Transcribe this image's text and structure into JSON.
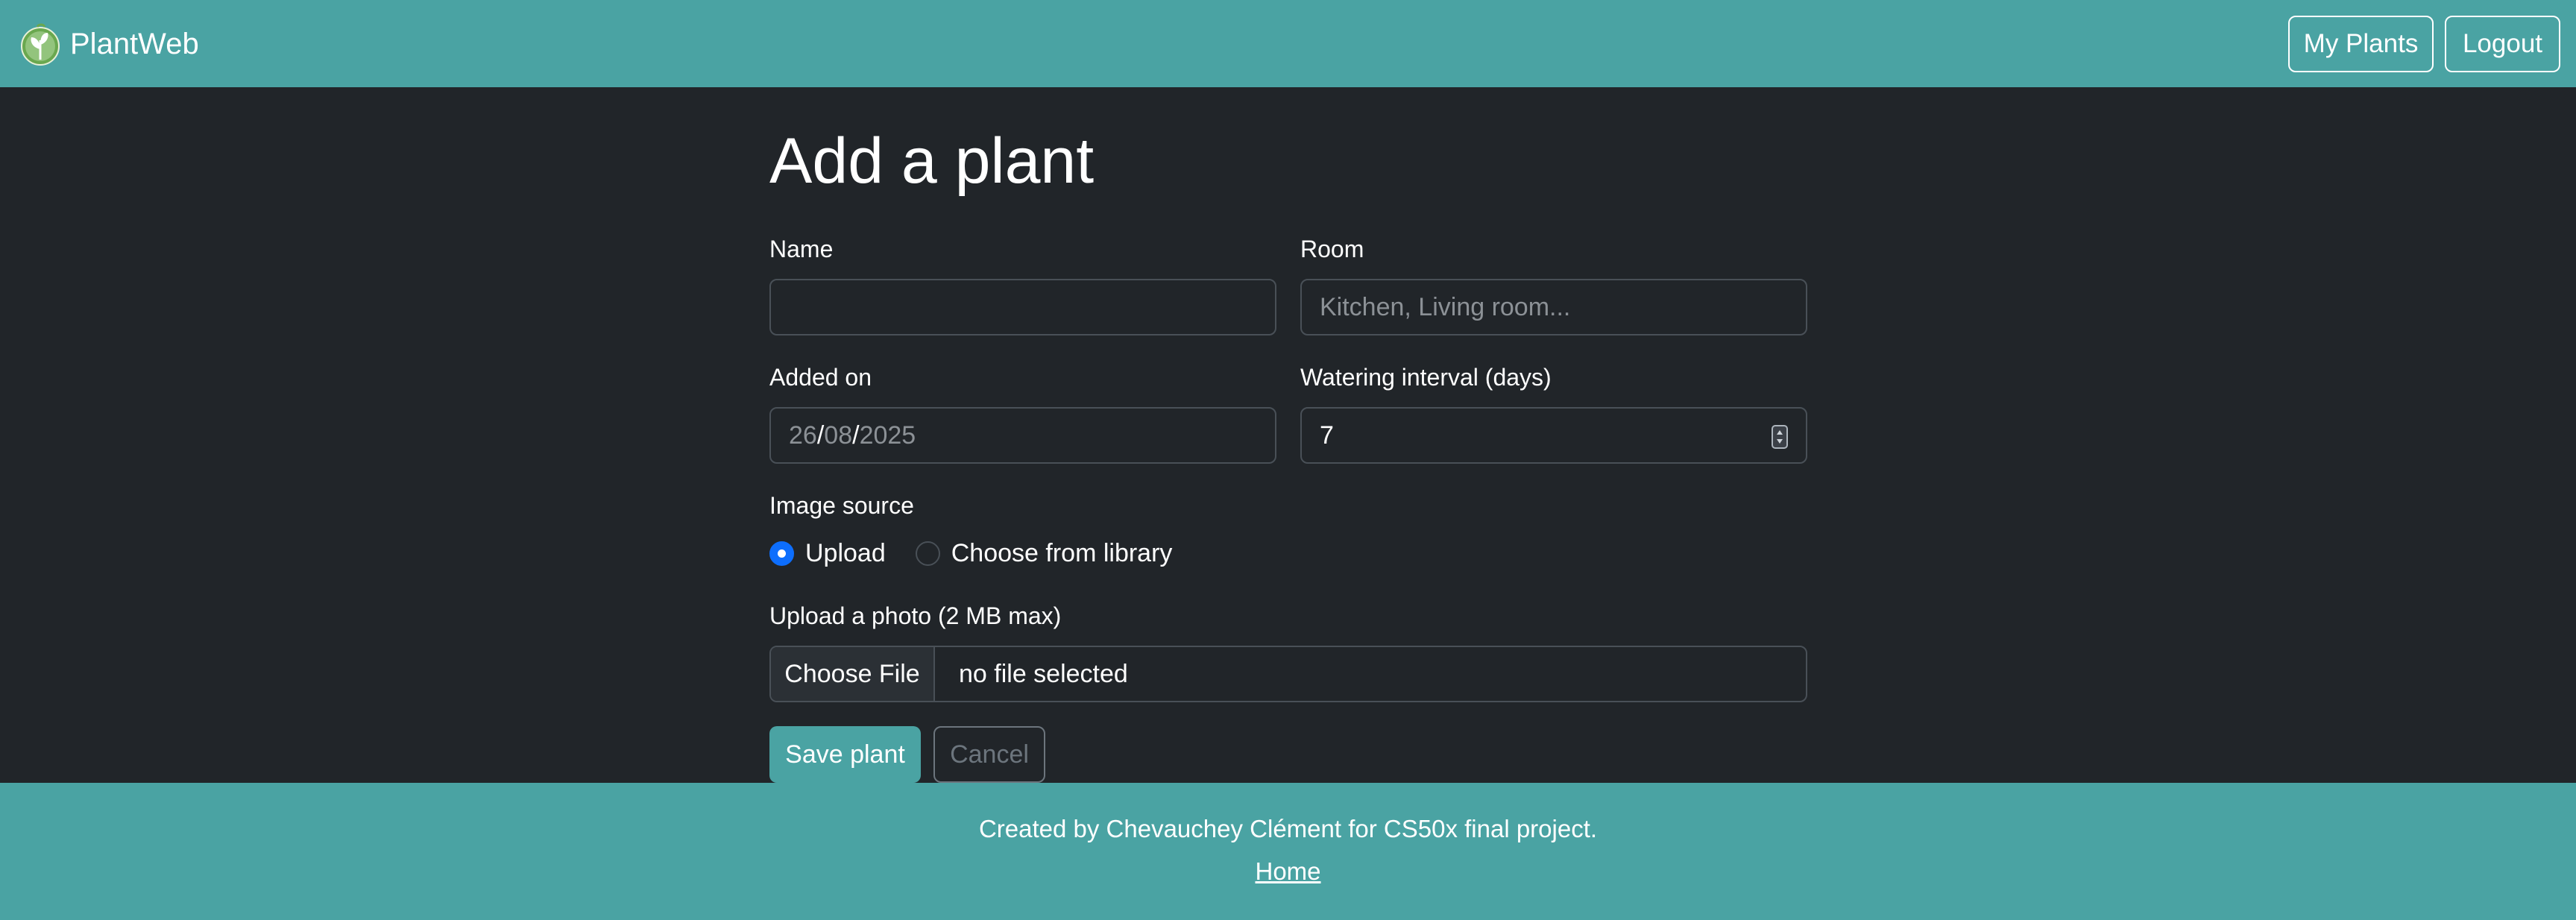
{
  "navbar": {
    "brand": "PlantWeb",
    "logo_icon": "plant-leaf-logo",
    "buttons": [
      {
        "label": "My Plants"
      },
      {
        "label": "Logout"
      }
    ]
  },
  "form": {
    "title": "Add a plant",
    "name": {
      "label": "Name",
      "value": "",
      "placeholder": ""
    },
    "room": {
      "label": "Room",
      "value": "",
      "placeholder": "Kitchen, Living room..."
    },
    "added_on": {
      "label": "Added on",
      "day": "26",
      "month": "08",
      "year": "2025",
      "separator": "/"
    },
    "watering": {
      "label": "Watering interval (days)",
      "value": "7"
    },
    "image_source": {
      "label": "Image source",
      "options": [
        {
          "label": "Upload",
          "selected": true
        },
        {
          "label": "Choose from library",
          "selected": false
        }
      ]
    },
    "upload": {
      "label": "Upload a photo (2 MB max)",
      "button": "Choose File",
      "status": "no file selected"
    },
    "save_label": "Save plant",
    "cancel_label": "Cancel"
  },
  "footer": {
    "credit": "Created by Chevauchey Clément for CS50x final project.",
    "home_link": "Home"
  },
  "colors": {
    "teal": "#4aa3a3",
    "background": "#212529",
    "radio_selected": "#0d6efd"
  }
}
